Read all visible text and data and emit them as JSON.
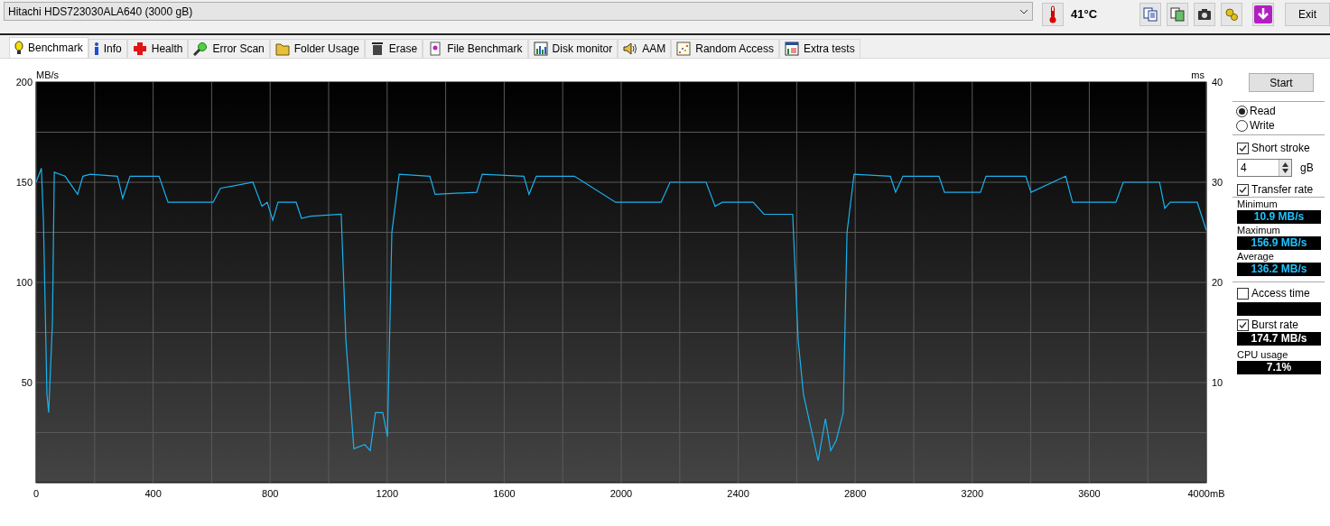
{
  "drive_selector": {
    "value": "Hitachi HDS723030ALA640 (3000 gB)"
  },
  "temperature": "41°C",
  "exit_button": "Exit",
  "tabs": [
    {
      "label": "Benchmark",
      "selected": true
    },
    {
      "label": "Info",
      "selected": false
    },
    {
      "label": "Health",
      "selected": false
    },
    {
      "label": "Error Scan",
      "selected": false
    },
    {
      "label": "Folder Usage",
      "selected": false
    },
    {
      "label": "Erase",
      "selected": false
    },
    {
      "label": "File Benchmark",
      "selected": false
    },
    {
      "label": "Disk monitor",
      "selected": false
    },
    {
      "label": "AAM",
      "selected": false
    },
    {
      "label": "Random Access",
      "selected": false
    },
    {
      "label": "Extra tests",
      "selected": false
    }
  ],
  "benchmark": {
    "chart_data": {
      "type": "line",
      "ylabel": "MB/s",
      "xlim": [
        0,
        4000
      ],
      "ylim": [
        0,
        200
      ],
      "xticks": [
        0,
        400,
        800,
        1200,
        1600,
        2000,
        2400,
        2800,
        3200,
        3600,
        {
          "value": 4000,
          "label": "4000mB"
        }
      ],
      "yticks": [
        50,
        100,
        150,
        200
      ],
      "grid": true,
      "x": [
        0,
        18,
        25,
        37,
        43,
        56,
        62,
        99,
        142,
        160,
        185,
        278,
        296,
        321,
        420,
        451,
        605,
        630,
        741,
        772,
        790,
        809,
        827,
        889,
        907,
        938,
        1043,
        1059,
        1086,
        1123,
        1142,
        1160,
        1185,
        1201,
        1216,
        1241,
        1346,
        1364,
        1506,
        1525,
        1667,
        1685,
        1710,
        1840,
        1981,
        2136,
        2167,
        2290,
        2321,
        2346,
        2451,
        2488,
        2586,
        2605,
        2623,
        2673,
        2698,
        2716,
        2735,
        2759,
        2772,
        2796,
        2920,
        2938,
        2963,
        3086,
        3105,
        3228,
        3247,
        3383,
        3401,
        3519,
        3543,
        3691,
        3716,
        3840,
        3858,
        3877,
        3969,
        4000
      ],
      "series": [
        {
          "color": "#1ab2ee",
          "values": [
            150,
            157,
            131,
            44,
            35,
            80,
            155,
            153,
            144,
            153,
            154,
            153,
            142,
            153,
            153,
            140,
            140,
            147,
            150,
            138,
            140,
            131,
            140,
            140,
            132,
            133,
            134,
            71,
            17,
            19,
            16,
            35,
            35,
            23,
            125,
            154,
            153,
            144,
            145,
            154,
            153,
            144,
            153,
            153,
            140,
            140,
            150,
            150,
            138,
            140,
            140,
            134,
            134,
            71,
            44,
            11,
            32,
            16,
            21,
            35,
            125,
            154,
            153,
            145,
            153,
            153,
            145,
            145,
            153,
            153,
            145,
            153,
            140,
            140,
            150,
            150,
            137,
            140,
            140,
            126
          ]
        }
      ]
    },
    "secondary_axis": {
      "label": "ms",
      "ticks": [
        "40",
        "30",
        "20",
        "10"
      ]
    }
  },
  "controls": {
    "start_button": "Start",
    "modes": [
      {
        "label": "Read",
        "selected": true
      },
      {
        "label": "Write",
        "selected": false
      }
    ],
    "short_stroke": {
      "label": "Short stroke",
      "checked": true,
      "value": "4",
      "unit": "gB"
    },
    "transfer_rate": {
      "label": "Transfer rate",
      "checked": true
    },
    "stats": [
      {
        "label": "Minimum",
        "value": "10.9 MB/s"
      },
      {
        "label": "Maximum",
        "value": "156.9 MB/s"
      },
      {
        "label": "Average",
        "value": "136.2 MB/s"
      }
    ],
    "access_time": {
      "label": "Access time",
      "checked": false
    },
    "burst_rate": {
      "label": "Burst rate",
      "checked": true,
      "value": "174.7 MB/s"
    },
    "cpu_usage": {
      "label": "CPU usage",
      "value": "7.1%"
    }
  }
}
